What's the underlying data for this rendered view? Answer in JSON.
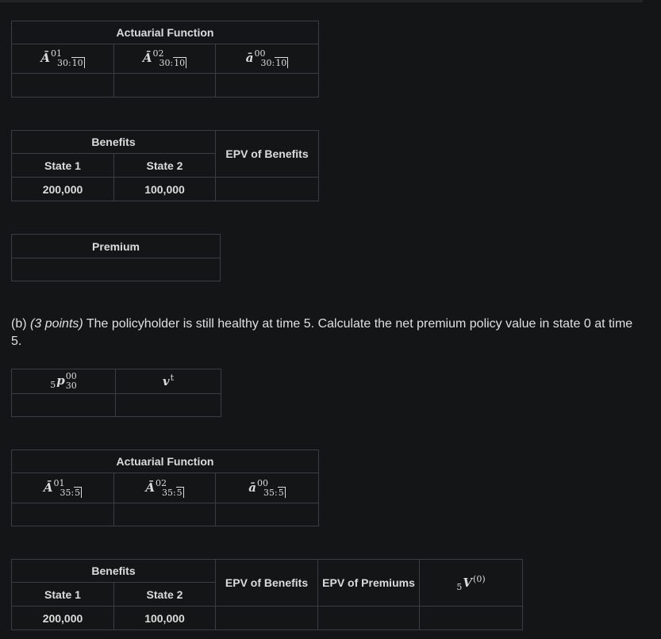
{
  "table1": {
    "header": "Actuarial Function",
    "cols": [
      {
        "base": "Ā",
        "sup": "01",
        "sub": "30:",
        "angle": "10"
      },
      {
        "base": "Ā",
        "sup": "02",
        "sub": "30:",
        "angle": "10"
      },
      {
        "base": "ā",
        "sup": "00",
        "sub": "30:",
        "angle": "10"
      }
    ]
  },
  "table2": {
    "benefits_header": "Benefits",
    "epv_header": "EPV of Benefits",
    "state1": "State 1",
    "state2": "State 2",
    "state1_value": "200,000",
    "state2_value": "100,000"
  },
  "table3": {
    "header": "Premium"
  },
  "part_b": {
    "label": "(b)",
    "points": "(3 points)",
    "text": "The policyholder is still healthy at time 5. Calculate the net premium policy value in state 0 at time 5."
  },
  "table4": {
    "col1": {
      "pre": "5",
      "base": "p",
      "sup": "00",
      "sub": "30"
    },
    "col2": {
      "base": "v",
      "sup": "t"
    }
  },
  "table5": {
    "header": "Actuarial Function",
    "cols": [
      {
        "base": "Ā",
        "sup": "01",
        "sub": "35:",
        "angle": "5"
      },
      {
        "base": "Ā",
        "sup": "02",
        "sub": "35:",
        "angle": "5"
      },
      {
        "base": "ā",
        "sup": "00",
        "sub": "35:",
        "angle": "5"
      }
    ]
  },
  "table6": {
    "benefits_header": "Benefits",
    "epv_benefits_header": "EPV of Benefits",
    "epv_premiums_header": "EPV of Premiums",
    "state1": "State 1",
    "state2": "State 2",
    "state1_value": "200,000",
    "state2_value": "100,000",
    "policy_value": {
      "pre": "5",
      "base": "V",
      "sup": "(0)"
    }
  }
}
